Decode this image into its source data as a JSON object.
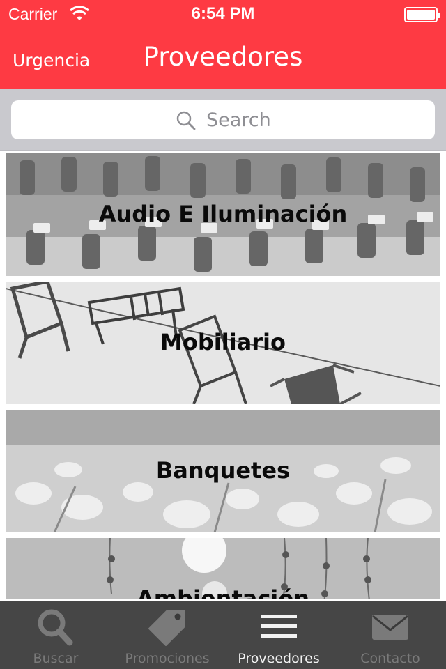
{
  "status_bar": {
    "carrier": "Carrier",
    "time": "6:54 PM"
  },
  "nav": {
    "back_label": "Urgencia",
    "title": "Proveedores"
  },
  "search": {
    "placeholder": "Search"
  },
  "categories": [
    {
      "label": "Audio E Iluminación"
    },
    {
      "label": "Mobiliario"
    },
    {
      "label": "Banquetes"
    },
    {
      "label": "Ambientación"
    }
  ],
  "tabs": [
    {
      "label": "Buscar",
      "icon": "search-icon",
      "active": false
    },
    {
      "label": "Promociones",
      "icon": "tag-icon",
      "active": false
    },
    {
      "label": "Proveedores",
      "icon": "list-icon",
      "active": true
    },
    {
      "label": "Contacto",
      "icon": "envelope-icon",
      "active": false
    }
  ],
  "colors": {
    "nav_background": "#fe3a43",
    "tabbar_background": "#3a3a3a",
    "tab_active": "#f2f2f2",
    "tab_inactive": "#7a7a7a"
  }
}
